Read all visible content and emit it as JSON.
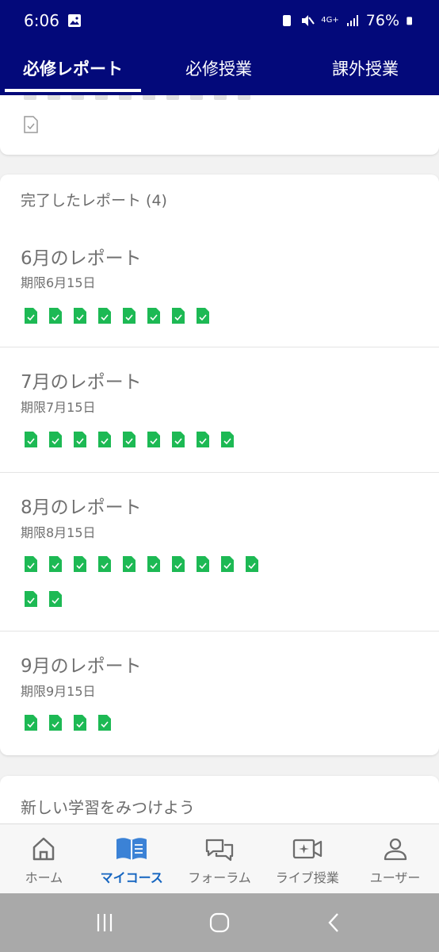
{
  "status": {
    "time": "6:06",
    "battery": "76%",
    "network": "4G+"
  },
  "tabs": [
    {
      "label": "必修レポート",
      "active": true
    },
    {
      "label": "必修授業",
      "active": false
    },
    {
      "label": "課外授業",
      "active": false
    }
  ],
  "completed": {
    "title": "完了したレポート (4)",
    "reports": [
      {
        "title": "6月のレポート",
        "due": "期限6月15日",
        "count": 8
      },
      {
        "title": "7月のレポート",
        "due": "期限7月15日",
        "count": 9
      },
      {
        "title": "8月のレポート",
        "due": "期限8月15日",
        "count": 12
      },
      {
        "title": "9月のレポート",
        "due": "期限9月15日",
        "count": 4
      }
    ]
  },
  "discover": {
    "title": "新しい学習をみつけよう"
  },
  "bottom_nav": [
    {
      "label": "ホーム",
      "icon": "home-icon",
      "active": false
    },
    {
      "label": "マイコース",
      "icon": "book-icon",
      "active": true
    },
    {
      "label": "フォーラム",
      "icon": "chat-bubbles-icon",
      "active": false
    },
    {
      "label": "ライブ授業",
      "icon": "video-icon",
      "active": false
    },
    {
      "label": "ユーザー",
      "icon": "user-icon",
      "active": false
    }
  ],
  "colors": {
    "header": "#03097a",
    "check_green": "#1db954",
    "active_nav": "#1565c0"
  }
}
